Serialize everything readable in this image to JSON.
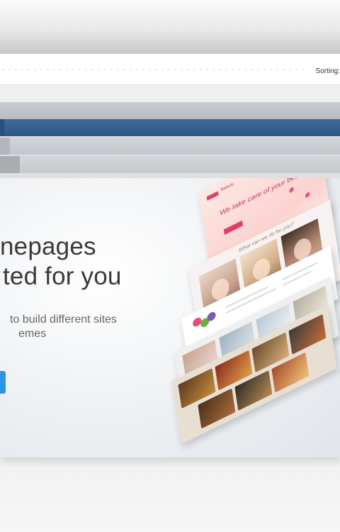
{
  "toolbar": {
    "sorting_label": "Sorting:"
  },
  "hero": {
    "title_line1": "nepages",
    "title_line2": "ted for you",
    "subtitle_line1": "to build different sites",
    "subtitle_line2": "emes"
  },
  "mockup": {
    "brand": "Beauty",
    "tagline": "We take care of your beauty",
    "section_caption": "What can we do for you?"
  },
  "colors": {
    "accent_blue": "#2c95e6",
    "brand_pink": "#e33b6b",
    "selected_bar": "#34608c"
  }
}
